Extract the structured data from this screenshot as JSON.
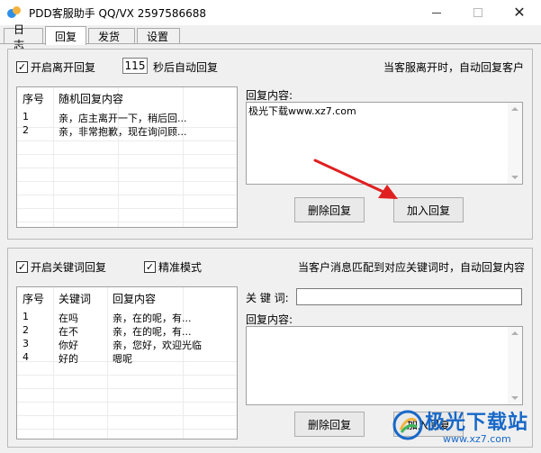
{
  "window": {
    "title": "PDD客服助手 QQ/VX 2597586688",
    "min_icon": "minimize-icon",
    "max_icon": "maximize-icon",
    "close_icon": "close-icon",
    "close_glyph": "✕"
  },
  "tabs": [
    {
      "label": "日志",
      "active": false
    },
    {
      "label": "回复",
      "active": true
    },
    {
      "label": "发货",
      "active": false
    },
    {
      "label": "设置",
      "active": false
    }
  ],
  "away_reply": {
    "enable_label": "开启离开回复",
    "enabled": true,
    "check_glyph": "✓",
    "seconds_value": "115",
    "seconds_label": "秒后自动回复",
    "hint": "当客服离开时，自动回复客户",
    "list": {
      "columns": [
        "序号",
        "随机回复内容"
      ],
      "rows": [
        [
          "1",
          "亲，店主离开一下，稍后回..."
        ],
        [
          "2",
          "亲，非常抱歉，现在询问顾..."
        ]
      ]
    },
    "content_label": "回复内容:",
    "content_value": "极光下载www.xz7.com",
    "delete_button": "删除回复",
    "add_button": "加入回复"
  },
  "keyword_reply": {
    "enable_label": "开启关键词回复",
    "enabled": true,
    "exact_label": "精准模式",
    "exact_enabled": true,
    "check_glyph": "✓",
    "hint": "当客户消息匹配到对应关键词时，自动回复内容",
    "list": {
      "columns": [
        "序号",
        "关键词",
        "回复内容"
      ],
      "rows": [
        [
          "1",
          "在吗",
          "亲，在的呢，有..."
        ],
        [
          "2",
          "在不",
          "亲，在的呢，有..."
        ],
        [
          "3",
          "你好",
          "亲，您好，欢迎光临"
        ],
        [
          "4",
          "好的",
          "嗯呢"
        ]
      ]
    },
    "keyword_label": "关 键 词:",
    "keyword_value": "",
    "content_label": "回复内容:",
    "content_value": "",
    "delete_button": "删除回复",
    "add_button": "加入回复"
  },
  "watermark": {
    "title": "极光下载站",
    "url": "www.xz7.com",
    "logo_icon": "aurora-logo-icon"
  },
  "colors": {
    "accent_arrow": "#e02020",
    "watermark_blue": "#1768c8"
  }
}
